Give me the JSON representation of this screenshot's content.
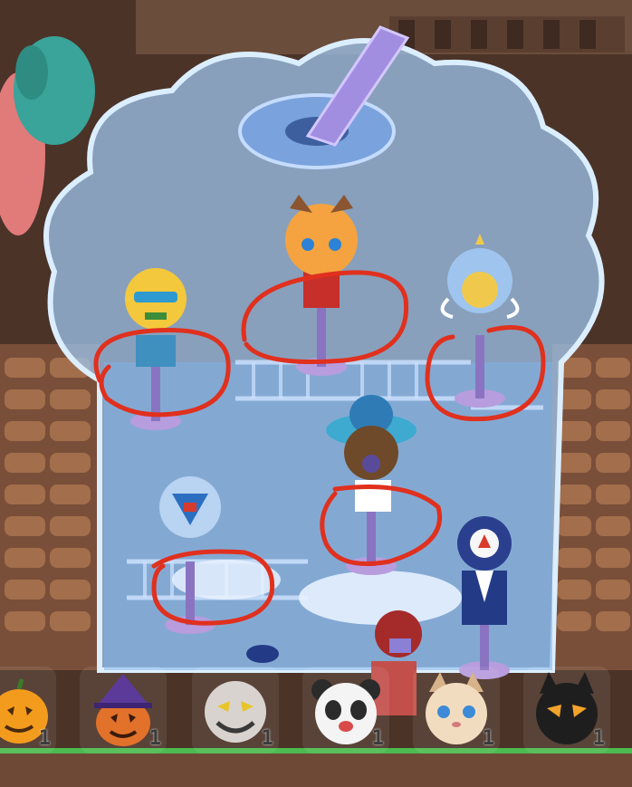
{
  "palette": {
    "wood_dark": "#4b3328",
    "wood_mid": "#7a4f39",
    "wood_light": "#a36e4c",
    "glass_light": "#cfe7ff",
    "glass_mid": "#8db9ea",
    "glass_dark": "#5a7fc3",
    "stand_purple": "#b79cde",
    "red_circle": "#e0301e",
    "grass": "#4bbb4f"
  },
  "hotbar": {
    "items": [
      {
        "name": "jack-o-lantern-mask",
        "icon": "pumpkin-icon",
        "count": "1"
      },
      {
        "name": "witch-pumpkin-mask",
        "icon": "witch-pumpkin-icon",
        "count": "1"
      },
      {
        "name": "grinning-ghost-mask",
        "icon": "ghost-face-icon",
        "count": "1"
      },
      {
        "name": "panda-mask",
        "icon": "panda-face-icon",
        "count": "1"
      },
      {
        "name": "cat-mask",
        "icon": "cat-face-icon",
        "count": "1"
      },
      {
        "name": "black-cat-mask",
        "icon": "black-cat-icon",
        "count": "1"
      }
    ]
  },
  "mannequins": [
    {
      "name": "yellow-hair-goggles",
      "circled": true
    },
    {
      "name": "dragon-helmet",
      "circled": true
    },
    {
      "name": "angel-blue-hood",
      "circled": true
    },
    {
      "name": "sombrero-brown-hair",
      "circled": true
    },
    {
      "name": "silver-mech-helmet",
      "circled": true
    },
    {
      "name": "navy-hat-coat",
      "circled": false
    }
  ]
}
